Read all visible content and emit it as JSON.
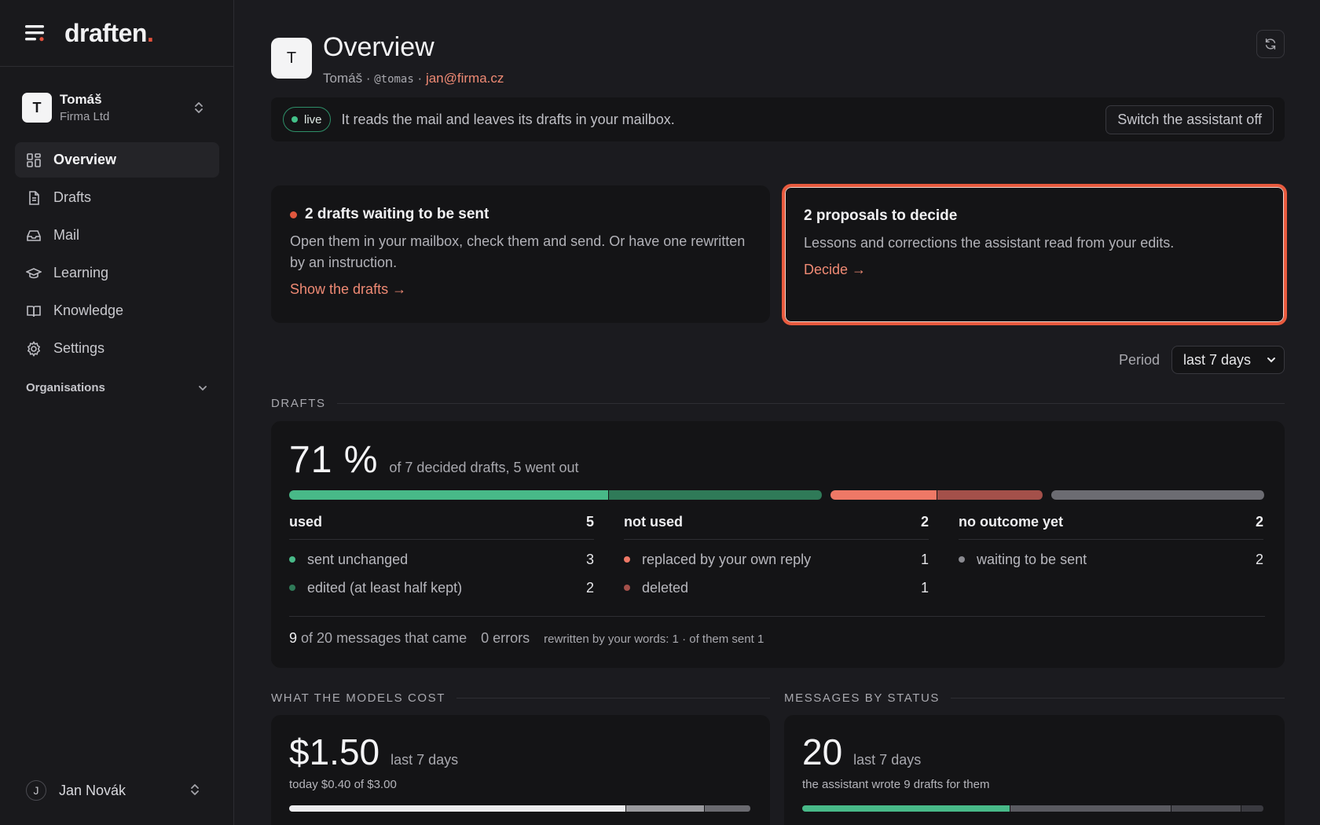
{
  "brand": {
    "name": "draften",
    "dot": "."
  },
  "tenant": {
    "initial": "T",
    "name": "Tomáš",
    "company": "Firma Ltd"
  },
  "nav": [
    {
      "label": "Overview",
      "icon": "grid-icon",
      "active": true
    },
    {
      "label": "Drafts",
      "icon": "document-icon"
    },
    {
      "label": "Mail",
      "icon": "inbox-icon"
    },
    {
      "label": "Learning",
      "icon": "graduation-cap-icon"
    },
    {
      "label": "Knowledge",
      "icon": "book-icon"
    },
    {
      "label": "Settings",
      "icon": "gear-icon"
    }
  ],
  "organisations": {
    "label": "Organisations"
  },
  "user": {
    "initial": "J",
    "name": "Jan Novák"
  },
  "header": {
    "initial": "T",
    "title": "Overview",
    "name": "Tomáš",
    "sep": "·",
    "handle": "@tomas",
    "email": "jan@firma.cz"
  },
  "status": {
    "badge": "live",
    "message": "It reads the mail and leaves its drafts in your mailbox.",
    "switch_label": "Switch the assistant off"
  },
  "cards": {
    "drafts": {
      "title": "2 drafts waiting to be sent",
      "desc": "Open them in your mailbox, check them and send. Or have one rewritten by an instruction.",
      "link": "Show the drafts →"
    },
    "proposals": {
      "title": "2 proposals to decide",
      "desc": "Lessons and corrections the assistant read from your edits.",
      "link": "Decide →"
    }
  },
  "period": {
    "label": "Period",
    "value": "last 7 days"
  },
  "drafts_section": {
    "label": "DRAFTS",
    "big": "71 %",
    "big_sub": "of 7 decided drafts, 5 went out",
    "bar": [
      {
        "value": 3,
        "color": "#48b988"
      },
      {
        "value": 2,
        "color": "#2f7a58"
      },
      {
        "value": 1,
        "color": "#ee7866"
      },
      {
        "value": 1,
        "color": "#a4504a"
      },
      {
        "value": 2,
        "color": "#6c6c72"
      }
    ],
    "columns": [
      {
        "title": "used",
        "total": "5",
        "rows": [
          {
            "label": "sent unchanged",
            "value": "3",
            "color": "#48b988"
          },
          {
            "label": "edited (at least half kept)",
            "value": "2",
            "color": "#2f7a58"
          }
        ]
      },
      {
        "title": "not used",
        "total": "2",
        "rows": [
          {
            "label": "replaced by your own reply",
            "value": "1",
            "color": "#ee7866"
          },
          {
            "label": "deleted",
            "value": "1",
            "color": "#a4504a"
          }
        ]
      },
      {
        "title": "no outcome yet",
        "total": "2",
        "rows": [
          {
            "label": "waiting to be sent",
            "value": "2",
            "color": "#8a8a90"
          }
        ]
      }
    ],
    "footer": {
      "count": "9",
      "count_rest": "of 20 messages that came",
      "errors": "0 errors",
      "rewritten": "rewritten by your words: 1 · of them sent 1"
    }
  },
  "cost_section": {
    "label": "WHAT THE MODELS COST",
    "big": "$1.50",
    "sub": "last 7 days",
    "note": "today $0.40 of $3.00",
    "bar": [
      {
        "value": 0.73,
        "color": "#ececee"
      },
      {
        "value": 0.17,
        "color": "#9a9a9e"
      },
      {
        "value": 0.1,
        "color": "#6a6a70"
      }
    ]
  },
  "messages_section": {
    "label": "MESSAGES BY STATUS",
    "big": "20",
    "sub": "last 7 days",
    "note": "the assistant wrote 9 drafts for them",
    "bar": [
      {
        "value": 9,
        "color": "#48b988"
      },
      {
        "value": 7,
        "color": "#5a5a60"
      },
      {
        "value": 3,
        "color": "#4a4a50"
      },
      {
        "value": 1,
        "color": "#3a3a40"
      }
    ]
  }
}
